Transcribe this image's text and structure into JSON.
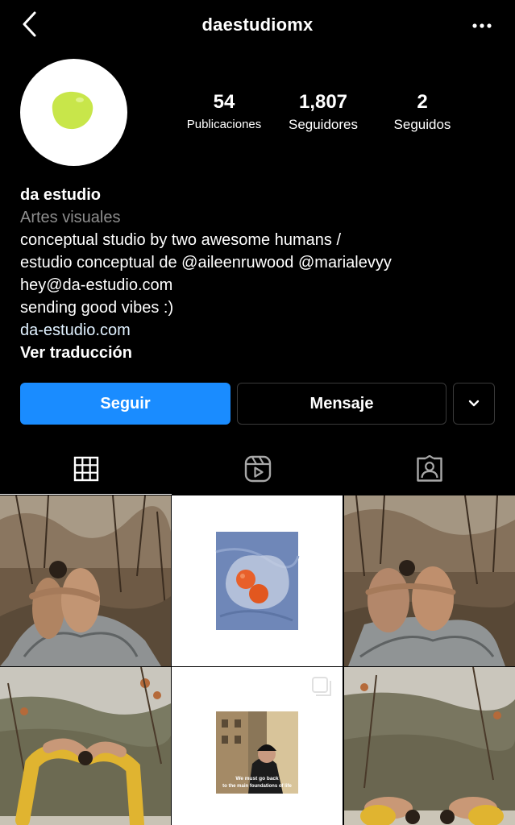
{
  "header": {
    "username": "daestudiomx",
    "back_icon": "chevron-left-icon",
    "more_icon": "more-horizontal-icon"
  },
  "avatar": {
    "icon": "lime-blob-logo",
    "color": "#c8e64a"
  },
  "stats": {
    "posts": {
      "value": "54",
      "label": "Publicaciones"
    },
    "followers": {
      "value": "1,807",
      "label": "Seguidores"
    },
    "following": {
      "value": "2",
      "label": "Seguidos"
    }
  },
  "bio": {
    "name": "da estudio",
    "category": "Artes visuales",
    "lines": [
      "conceptual studio by two awesome humans /",
      "estudio conceptual de @aileenruwood @marialevyy",
      "hey@da-estudio.com",
      "sending good vibes :)"
    ],
    "link": "da-estudio.com",
    "translate": "Ver traducción"
  },
  "actions": {
    "follow": "Seguir",
    "message": "Mensaje",
    "suggest_icon": "chevron-down-icon",
    "follow_color": "#1a8cff"
  },
  "tabs": [
    {
      "icon": "grid-icon",
      "active": true
    },
    {
      "icon": "reels-icon",
      "active": false
    },
    {
      "icon": "tagged-icon",
      "active": false
    }
  ],
  "posts": {
    "items": [
      {
        "image": "two-people-embracing-in-dry-forest"
      },
      {
        "image": "oranges-in-plastic-bag-on-blue-cloth"
      },
      {
        "image": "two-people-back-to-back-in-dry-forest"
      },
      {
        "image": "two-people-in-yellow-bending-backwards",
        "carousel": false
      },
      {
        "image": "man-in-beanie-meme",
        "carousel": true
      },
      {
        "image": "two-people-in-yellow-child-pose"
      }
    ],
    "meme_caption_line1": "We must go back",
    "meme_caption_line2": "to the main foundations of life"
  }
}
